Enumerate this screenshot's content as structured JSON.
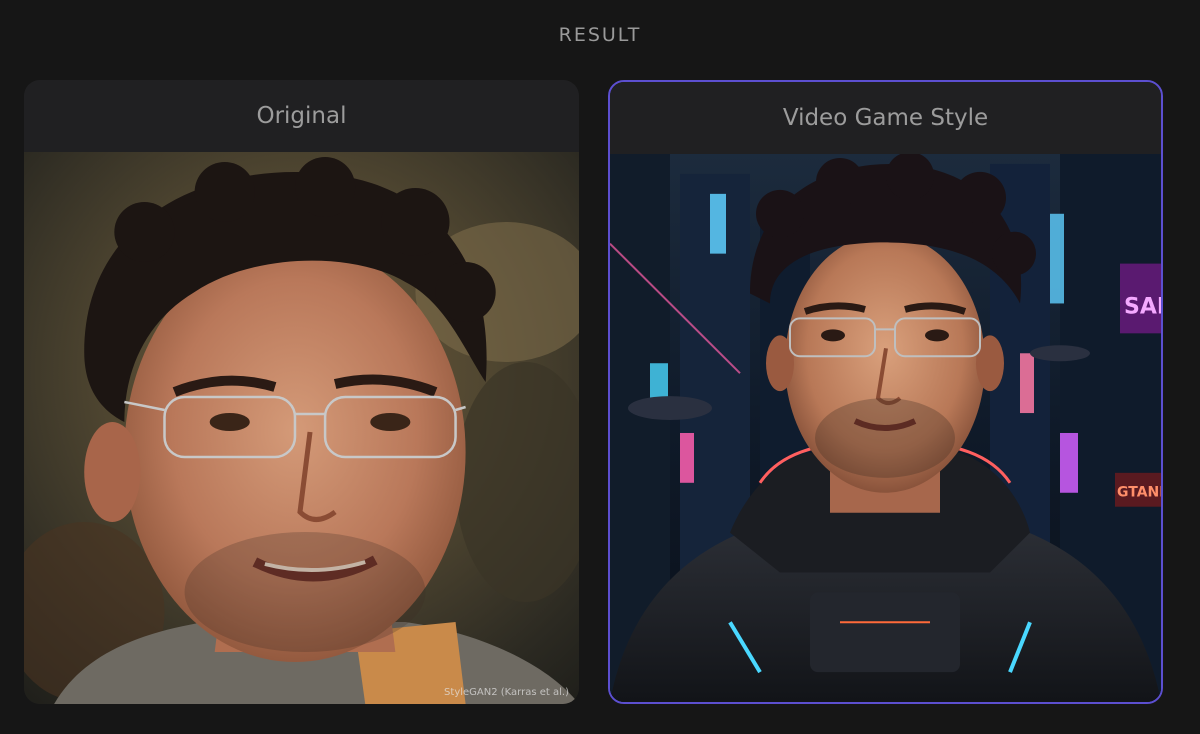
{
  "header": {
    "title": "RESULT"
  },
  "cards": [
    {
      "label": "Original",
      "image": {
        "alt": "",
        "watermark": "StyleGAN2 (Karras et al.)"
      }
    },
    {
      "label": "Video Game Style",
      "image": {
        "alt": "",
        "signs": [
          "SARE",
          "GTANE"
        ]
      },
      "selected": true
    }
  ],
  "colors": {
    "background": "#161616",
    "card": "#1f1f21",
    "selected_border": "#5c4fd0",
    "label_text": "#9c9c9c"
  }
}
